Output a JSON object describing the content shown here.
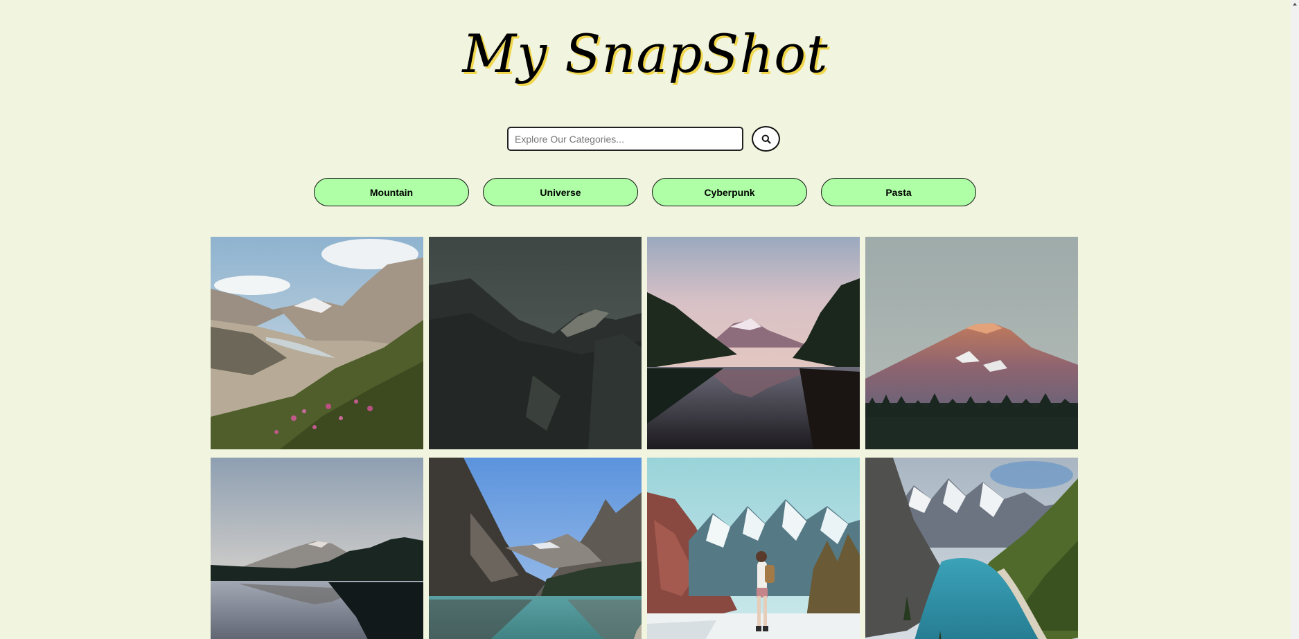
{
  "header": {
    "title": "My SnapShot"
  },
  "search": {
    "placeholder": "Explore Our Categories...",
    "value": "",
    "button_icon": "search-icon"
  },
  "categories": [
    {
      "label": "Mountain"
    },
    {
      "label": "Universe"
    },
    {
      "label": "Cyberpunk"
    },
    {
      "label": "Pasta"
    }
  ],
  "colors": {
    "background": "#f1f4de",
    "category_button": "#aeffa6",
    "title_shadow": "#f0d64b"
  },
  "gallery": {
    "photos": [
      {
        "subject": "glacier valley with pink wildflowers"
      },
      {
        "subject": "dark misty mountain ridge"
      },
      {
        "subject": "snow peak reflected in lake at dusk"
      },
      {
        "subject": "snow-capped volcano at sunset above forest"
      },
      {
        "subject": "distant mountain over calm lake with pines"
      },
      {
        "subject": "rocky peaks above turquoise lake"
      },
      {
        "subject": "hiker before snowy peaks and frozen lake"
      },
      {
        "subject": "turquoise glacial lake in mountain valley"
      }
    ]
  }
}
